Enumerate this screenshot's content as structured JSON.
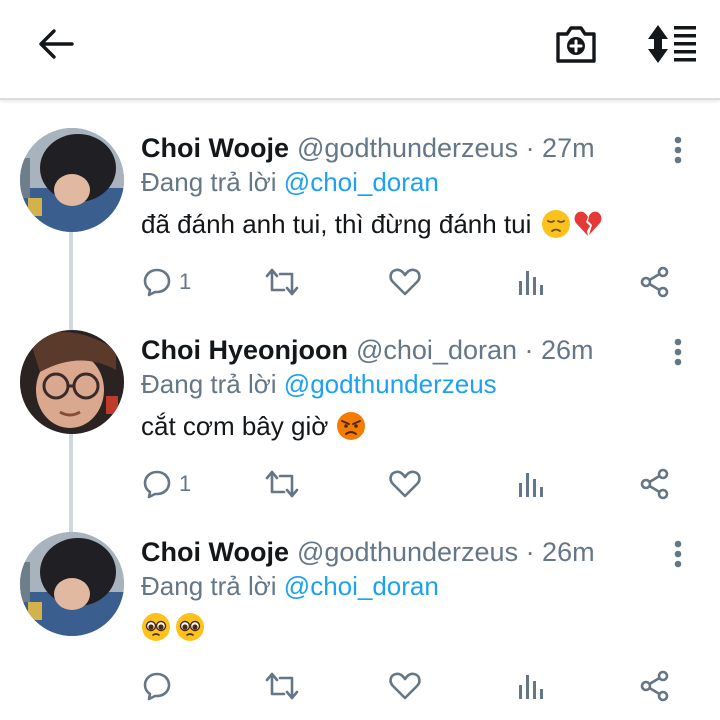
{
  "header": {
    "back_icon": "arrow-left-icon",
    "camera_icon": "camera-plus-icon",
    "sort_icon": "sort-lines-icon"
  },
  "colors": {
    "link": "#1da1f2",
    "secondary_text": "#657786",
    "thread_line": "#cfd9de"
  },
  "tweets": [
    {
      "name": "Choi Wooje",
      "handle": "@godthunderzeus · 27m",
      "reply_prefix": "Đang trả lời",
      "reply_mention": "@choi_doran",
      "text": "đã đánh anh tui, thì đừng đánh tui",
      "emojis": [
        "pensive-face",
        "broken-heart"
      ],
      "reply_count": "1"
    },
    {
      "name": "Choi Hyeonjoon",
      "handle": "@choi_doran · 26m",
      "reply_prefix": "Đang trả lời",
      "reply_mention": "@godthunderzeus",
      "text": "cắt cơm bây giờ",
      "emojis": [
        "angry-face"
      ],
      "reply_count": "1"
    },
    {
      "name": "Choi Wooje",
      "handle": "@godthunderzeus · 26m",
      "reply_prefix": "Đang trả lời",
      "reply_mention": "@choi_doran",
      "text": "",
      "emojis": [
        "pleading-face",
        "pleading-face"
      ],
      "reply_count": ""
    }
  ]
}
